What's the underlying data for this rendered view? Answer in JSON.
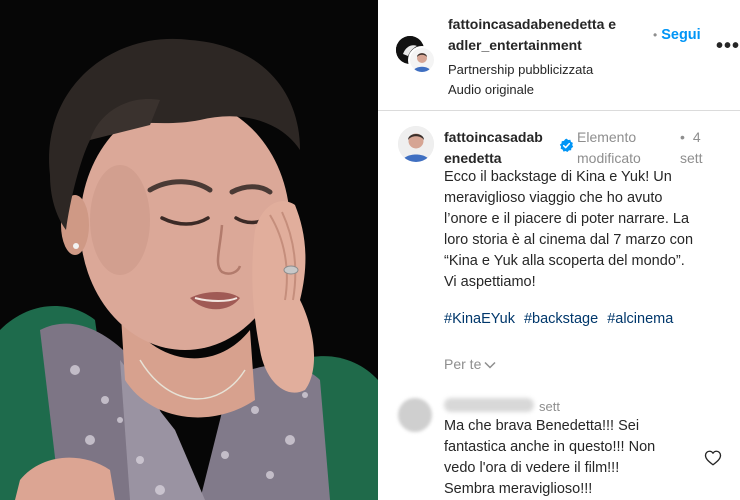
{
  "post": {
    "header": {
      "username_line1": "fattoincasadabenedetta e",
      "username_line2": "adler_entertainment",
      "follow_label": "Segui",
      "meta_line1": "Partnership pubblicizzata",
      "meta_line2": "Audio originale",
      "more_icon": "more-options-icon"
    },
    "caption": {
      "username_line1": "fattoincasadab",
      "username_line2": "enedetta",
      "verified_icon": "verified-badge-icon",
      "edited_line1": "Elemento",
      "edited_line2": "modificato",
      "time_line1": "4",
      "time_line2": "sett",
      "text_lines": [
        "Ecco il backstage di Kina e Yuk! Un",
        "meraviglioso viaggio che ho avuto",
        "l’onore e il piacere di poter narrare. La",
        "loro storia è al cinema dal 7 marzo con",
        "“Kina e Yuk alla scoperta del mondo”.",
        "Vi aspettiamo!"
      ],
      "hashtags": [
        "#KinaEYuk",
        "#backstage",
        "#alcinema"
      ],
      "see_translation_label": "Per te"
    },
    "comment": {
      "time": "sett",
      "text_lines": [
        "Ma che brava Benedetta!!! Sei",
        "fantastica anche in questo!!! Non",
        "vedo l'ora di vedere il film!!!",
        "Sembra meraviglioso!!!"
      ],
      "like_icon": "heart-icon"
    },
    "colors": {
      "link_blue": "#0095f6",
      "hashtag_blue": "#00376b",
      "muted_gray": "#8e8e8e",
      "text_dark": "#262626",
      "media_background": "#050505"
    }
  }
}
